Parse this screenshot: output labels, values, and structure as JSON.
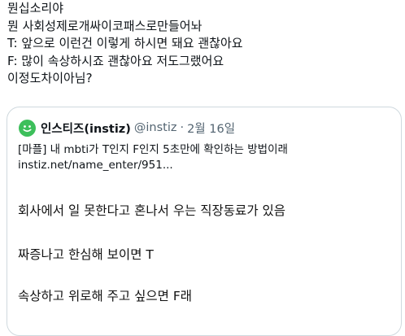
{
  "tweet": {
    "lines": [
      "뭔십소리야",
      "뭔 사회성제로개싸이코패스로만들어놔",
      "T: 앞으로 이런건 이렇게 하시면 돼요 괜찮아요",
      "F: 많이 속상하시죠 괜찮아요 저도그랬어요",
      "이정도차이아님?"
    ]
  },
  "quote": {
    "author_name": "인스티즈(instiz)",
    "handle": "@instiz",
    "separator": "·",
    "date": "2월 16일",
    "text_line1": "[마플] 내 mbti가 T인지 F인지 5초만에 확인하는 방법이래",
    "text_line2": "instiz.net/name_enter/951...",
    "avatar_color": "#3dbf5b",
    "image_text": [
      "회사에서 일 못한다고 혼나서 우는 직장동료가 있음",
      "짜증나고 한심해 보이면 T",
      "속상하고 위로해 주고 싶으면 F래"
    ]
  },
  "colors": {
    "text": "#0f1419",
    "secondary": "#536471",
    "border": "#cfd9de"
  }
}
